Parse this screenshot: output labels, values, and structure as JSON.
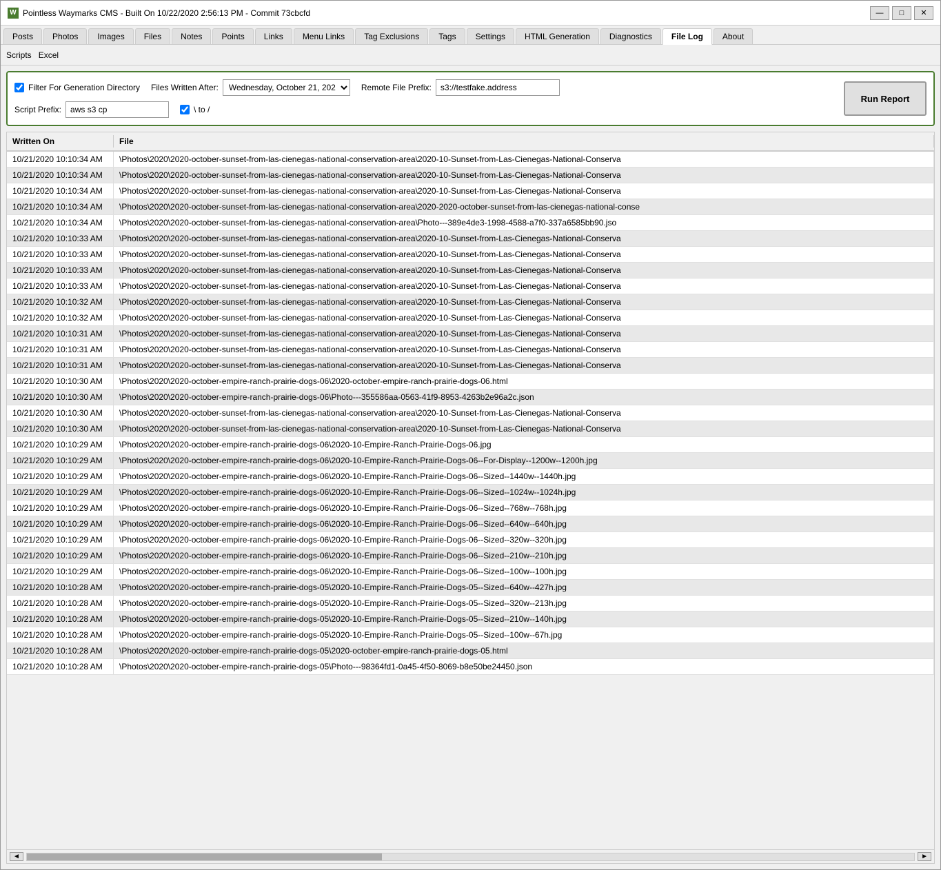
{
  "window": {
    "title": "Pointless Waymarks CMS - Built On 10/22/2020 2:56:13 PM - Commit 73cbcfd",
    "icon": "W"
  },
  "title_controls": {
    "minimize": "—",
    "maximize": "□",
    "close": "✕"
  },
  "tabs": [
    {
      "label": "Posts",
      "active": false
    },
    {
      "label": "Photos",
      "active": false
    },
    {
      "label": "Images",
      "active": false
    },
    {
      "label": "Files",
      "active": false
    },
    {
      "label": "Notes",
      "active": false
    },
    {
      "label": "Points",
      "active": false
    },
    {
      "label": "Links",
      "active": false
    },
    {
      "label": "Menu Links",
      "active": false
    },
    {
      "label": "Tag Exclusions",
      "active": false
    },
    {
      "label": "Tags",
      "active": false
    },
    {
      "label": "Settings",
      "active": false
    },
    {
      "label": "HTML Generation",
      "active": false
    },
    {
      "label": "Diagnostics",
      "active": false
    },
    {
      "label": "File Log",
      "active": true
    },
    {
      "label": "About",
      "active": false
    }
  ],
  "secondary_bar": [
    {
      "label": "Scripts"
    },
    {
      "label": "Excel"
    }
  ],
  "options": {
    "filter_checkbox_label": "Filter For Generation Directory",
    "filter_checked": true,
    "files_written_after_label": "Files Written After:",
    "files_written_after_value": "Wednesday, October 21, 202",
    "remote_file_prefix_label": "Remote File Prefix:",
    "remote_file_prefix_value": "s3://testfake.address",
    "script_prefix_label": "Script Prefix:",
    "script_prefix_value": "aws s3 cp",
    "slash_checkbox_label": "\\ to /",
    "slash_checked": true,
    "run_report_label": "Run Report"
  },
  "table": {
    "columns": [
      "Written On",
      "File"
    ],
    "rows": [
      {
        "written_on": "10/21/2020 10:10:34 AM",
        "file": "\\Photos\\2020\\2020-october-sunset-from-las-cienegas-national-conservation-area\\2020-10-Sunset-from-Las-Cienegas-National-Conserva"
      },
      {
        "written_on": "10/21/2020 10:10:34 AM",
        "file": "\\Photos\\2020\\2020-october-sunset-from-las-cienegas-national-conservation-area\\2020-10-Sunset-from-Las-Cienegas-National-Conserva"
      },
      {
        "written_on": "10/21/2020 10:10:34 AM",
        "file": "\\Photos\\2020\\2020-october-sunset-from-las-cienegas-national-conservation-area\\2020-10-Sunset-from-Las-Cienegas-National-Conserva"
      },
      {
        "written_on": "10/21/2020 10:10:34 AM",
        "file": "\\Photos\\2020\\2020-october-sunset-from-las-cienegas-national-conservation-area\\2020-2020-october-sunset-from-las-cienegas-national-conse"
      },
      {
        "written_on": "10/21/2020 10:10:34 AM",
        "file": "\\Photos\\2020\\2020-october-sunset-from-las-cienegas-national-conservation-area\\Photo---389e4de3-1998-4588-a7f0-337a6585bb90.jso"
      },
      {
        "written_on": "10/21/2020 10:10:33 AM",
        "file": "\\Photos\\2020\\2020-october-sunset-from-las-cienegas-national-conservation-area\\2020-10-Sunset-from-Las-Cienegas-National-Conserva"
      },
      {
        "written_on": "10/21/2020 10:10:33 AM",
        "file": "\\Photos\\2020\\2020-october-sunset-from-las-cienegas-national-conservation-area\\2020-10-Sunset-from-Las-Cienegas-National-Conserva"
      },
      {
        "written_on": "10/21/2020 10:10:33 AM",
        "file": "\\Photos\\2020\\2020-october-sunset-from-las-cienegas-national-conservation-area\\2020-10-Sunset-from-Las-Cienegas-National-Conserva"
      },
      {
        "written_on": "10/21/2020 10:10:33 AM",
        "file": "\\Photos\\2020\\2020-october-sunset-from-las-cienegas-national-conservation-area\\2020-10-Sunset-from-Las-Cienegas-National-Conserva"
      },
      {
        "written_on": "10/21/2020 10:10:32 AM",
        "file": "\\Photos\\2020\\2020-october-sunset-from-las-cienegas-national-conservation-area\\2020-10-Sunset-from-Las-Cienegas-National-Conserva"
      },
      {
        "written_on": "10/21/2020 10:10:32 AM",
        "file": "\\Photos\\2020\\2020-october-sunset-from-las-cienegas-national-conservation-area\\2020-10-Sunset-from-Las-Cienegas-National-Conserva"
      },
      {
        "written_on": "10/21/2020 10:10:31 AM",
        "file": "\\Photos\\2020\\2020-october-sunset-from-las-cienegas-national-conservation-area\\2020-10-Sunset-from-Las-Cienegas-National-Conserva"
      },
      {
        "written_on": "10/21/2020 10:10:31 AM",
        "file": "\\Photos\\2020\\2020-october-sunset-from-las-cienegas-national-conservation-area\\2020-10-Sunset-from-Las-Cienegas-National-Conserva"
      },
      {
        "written_on": "10/21/2020 10:10:31 AM",
        "file": "\\Photos\\2020\\2020-october-sunset-from-las-cienegas-national-conservation-area\\2020-10-Sunset-from-Las-Cienegas-National-Conserva"
      },
      {
        "written_on": "10/21/2020 10:10:30 AM",
        "file": "\\Photos\\2020\\2020-october-empire-ranch-prairie-dogs-06\\2020-october-empire-ranch-prairie-dogs-06.html"
      },
      {
        "written_on": "10/21/2020 10:10:30 AM",
        "file": "\\Photos\\2020\\2020-october-empire-ranch-prairie-dogs-06\\Photo---355586aa-0563-41f9-8953-4263b2e96a2c.json"
      },
      {
        "written_on": "10/21/2020 10:10:30 AM",
        "file": "\\Photos\\2020\\2020-october-sunset-from-las-cienegas-national-conservation-area\\2020-10-Sunset-from-Las-Cienegas-National-Conserva"
      },
      {
        "written_on": "10/21/2020 10:10:30 AM",
        "file": "\\Photos\\2020\\2020-october-sunset-from-las-cienegas-national-conservation-area\\2020-10-Sunset-from-Las-Cienegas-National-Conserva"
      },
      {
        "written_on": "10/21/2020 10:10:29 AM",
        "file": "\\Photos\\2020\\2020-october-empire-ranch-prairie-dogs-06\\2020-10-Empire-Ranch-Prairie-Dogs-06.jpg"
      },
      {
        "written_on": "10/21/2020 10:10:29 AM",
        "file": "\\Photos\\2020\\2020-october-empire-ranch-prairie-dogs-06\\2020-10-Empire-Ranch-Prairie-Dogs-06--For-Display--1200w--1200h.jpg"
      },
      {
        "written_on": "10/21/2020 10:10:29 AM",
        "file": "\\Photos\\2020\\2020-october-empire-ranch-prairie-dogs-06\\2020-10-Empire-Ranch-Prairie-Dogs-06--Sized--1440w--1440h.jpg"
      },
      {
        "written_on": "10/21/2020 10:10:29 AM",
        "file": "\\Photos\\2020\\2020-october-empire-ranch-prairie-dogs-06\\2020-10-Empire-Ranch-Prairie-Dogs-06--Sized--1024w--1024h.jpg"
      },
      {
        "written_on": "10/21/2020 10:10:29 AM",
        "file": "\\Photos\\2020\\2020-october-empire-ranch-prairie-dogs-06\\2020-10-Empire-Ranch-Prairie-Dogs-06--Sized--768w--768h.jpg"
      },
      {
        "written_on": "10/21/2020 10:10:29 AM",
        "file": "\\Photos\\2020\\2020-october-empire-ranch-prairie-dogs-06\\2020-10-Empire-Ranch-Prairie-Dogs-06--Sized--640w--640h.jpg"
      },
      {
        "written_on": "10/21/2020 10:10:29 AM",
        "file": "\\Photos\\2020\\2020-october-empire-ranch-prairie-dogs-06\\2020-10-Empire-Ranch-Prairie-Dogs-06--Sized--320w--320h.jpg"
      },
      {
        "written_on": "10/21/2020 10:10:29 AM",
        "file": "\\Photos\\2020\\2020-october-empire-ranch-prairie-dogs-06\\2020-10-Empire-Ranch-Prairie-Dogs-06--Sized--210w--210h.jpg"
      },
      {
        "written_on": "10/21/2020 10:10:29 AM",
        "file": "\\Photos\\2020\\2020-october-empire-ranch-prairie-dogs-06\\2020-10-Empire-Ranch-Prairie-Dogs-06--Sized--100w--100h.jpg"
      },
      {
        "written_on": "10/21/2020 10:10:28 AM",
        "file": "\\Photos\\2020\\2020-october-empire-ranch-prairie-dogs-05\\2020-10-Empire-Ranch-Prairie-Dogs-05--Sized--640w--427h.jpg"
      },
      {
        "written_on": "10/21/2020 10:10:28 AM",
        "file": "\\Photos\\2020\\2020-october-empire-ranch-prairie-dogs-05\\2020-10-Empire-Ranch-Prairie-Dogs-05--Sized--320w--213h.jpg"
      },
      {
        "written_on": "10/21/2020 10:10:28 AM",
        "file": "\\Photos\\2020\\2020-october-empire-ranch-prairie-dogs-05\\2020-10-Empire-Ranch-Prairie-Dogs-05--Sized--210w--140h.jpg"
      },
      {
        "written_on": "10/21/2020 10:10:28 AM",
        "file": "\\Photos\\2020\\2020-october-empire-ranch-prairie-dogs-05\\2020-10-Empire-Ranch-Prairie-Dogs-05--Sized--100w--67h.jpg"
      },
      {
        "written_on": "10/21/2020 10:10:28 AM",
        "file": "\\Photos\\2020\\2020-october-empire-ranch-prairie-dogs-05\\2020-october-empire-ranch-prairie-dogs-05.html"
      },
      {
        "written_on": "10/21/2020 10:10:28 AM",
        "file": "\\Photos\\2020\\2020-october-empire-ranch-prairie-dogs-05\\Photo---98364fd1-0a45-4f50-8069-b8e50be24450.json"
      }
    ]
  },
  "scrollbar": {
    "left_arrow": "◄",
    "right_arrow": "►"
  }
}
